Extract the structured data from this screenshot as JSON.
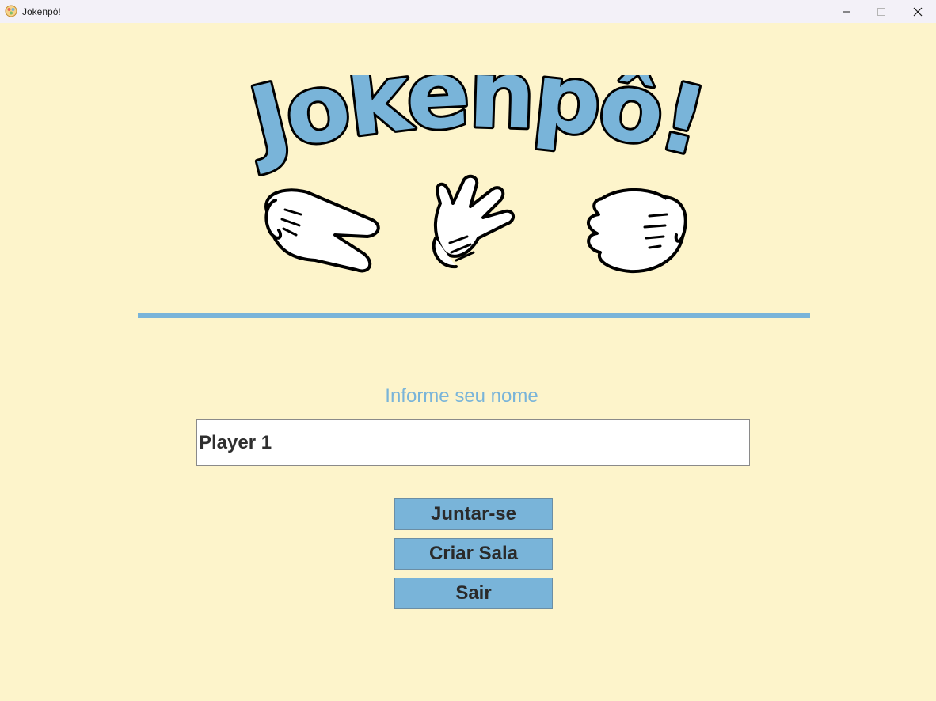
{
  "window": {
    "title": "Jokenpô!",
    "icon": "game-app-icon"
  },
  "logo": {
    "text": "Jokenpô!",
    "fill_color": "#79b4d9",
    "hands": [
      "scissors-hand-icon",
      "paper-hand-icon",
      "rock-hand-icon"
    ]
  },
  "form": {
    "prompt": "Informe seu nome",
    "name_value": "Player 1"
  },
  "menu": {
    "join_label": "Juntar-se",
    "create_label": "Criar Sala",
    "exit_label": "Sair"
  },
  "colors": {
    "background": "#fdf4cb",
    "accent": "#79b4d9",
    "button_text": "#2a2a2a"
  }
}
